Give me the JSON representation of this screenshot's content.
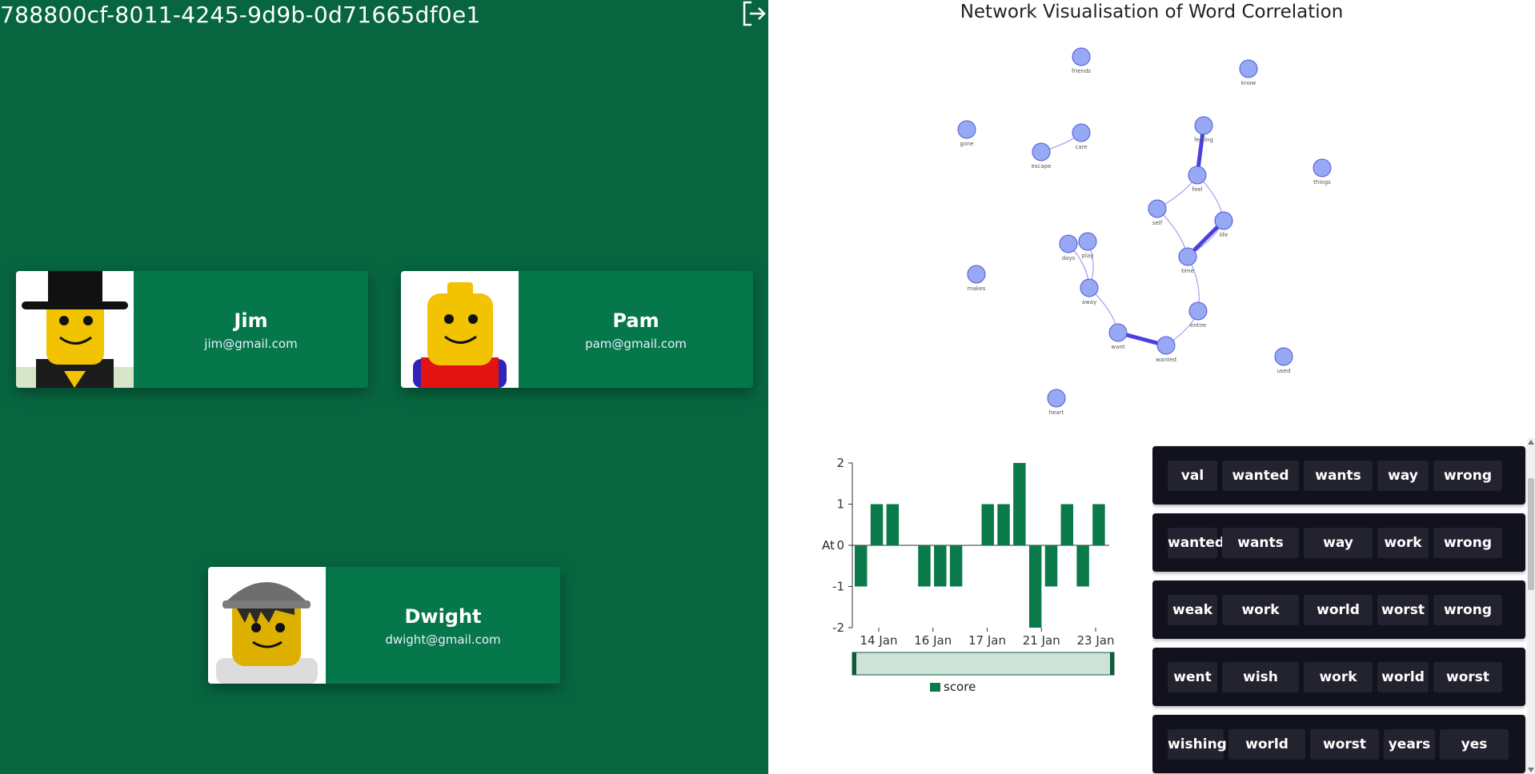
{
  "session": {
    "id": "788800cf-8011-4245-9d9b-0d71665df0e1"
  },
  "icons": {
    "logout": "logout-icon"
  },
  "users": [
    {
      "name": "Jim",
      "email": "jim@gmail.com",
      "avatar": "lego-minifig-top-hat"
    },
    {
      "name": "Pam",
      "email": "pam@gmail.com",
      "avatar": "lego-minifig-red-torso"
    },
    {
      "name": "Dwight",
      "email": "dwight@gmail.com",
      "avatar": "lego-minifig-grey-cap"
    }
  ],
  "network": {
    "title": "Network Visualisation of Word Correlation",
    "nodes": [
      "friends",
      "know",
      "gone",
      "care",
      "escape",
      "feeling",
      "feel",
      "things",
      "self",
      "life",
      "days",
      "play",
      "time",
      "makes",
      "away",
      "entire",
      "want",
      "wanted",
      "used",
      "heart"
    ],
    "edges": [
      {
        "source": "escape",
        "target": "care",
        "weight": 1
      },
      {
        "source": "feeling",
        "target": "feel",
        "weight": 4
      },
      {
        "source": "feel",
        "target": "self",
        "weight": 1
      },
      {
        "source": "feel",
        "target": "life",
        "weight": 1
      },
      {
        "source": "self",
        "target": "time",
        "weight": 1
      },
      {
        "source": "life",
        "target": "time",
        "weight": 1
      },
      {
        "source": "time",
        "target": "life",
        "weight": 4
      },
      {
        "source": "days",
        "target": "play",
        "weight": 1
      },
      {
        "source": "days",
        "target": "away",
        "weight": 1
      },
      {
        "source": "play",
        "target": "away",
        "weight": 1
      },
      {
        "source": "time",
        "target": "entire",
        "weight": 1
      },
      {
        "source": "away",
        "target": "want",
        "weight": 1
      },
      {
        "source": "want",
        "target": "wanted",
        "weight": 4
      },
      {
        "source": "wanted",
        "target": "entire",
        "weight": 1
      }
    ],
    "colors": {
      "node": "#97a8f4",
      "node_stroke": "#4f5ad6",
      "edge": "#4b3fe0"
    }
  },
  "chart_data": {
    "type": "bar",
    "title": "",
    "xlabel": "",
    "ylabel": "At",
    "ylim": [
      -2,
      2
    ],
    "y_ticks": [
      "2",
      "1",
      "0",
      "-1",
      "-2"
    ],
    "x_ticks": [
      "14 Jan",
      "16 Jan",
      "17 Jan",
      "21 Jan",
      "23 Jan"
    ],
    "series": [
      {
        "name": "score",
        "values": [
          -1,
          1,
          1,
          0,
          -1,
          -1,
          -1,
          0,
          1,
          1,
          2,
          -2,
          -1,
          1,
          -1,
          1
        ]
      }
    ],
    "color": "#0b7a4b",
    "legend": "bottom"
  },
  "word_groups": [
    [
      "val",
      "wanted",
      "wants",
      "way",
      "wrong"
    ],
    [
      "wanted",
      "wants",
      "way",
      "work",
      "wrong"
    ],
    [
      "weak",
      "work",
      "world",
      "worst",
      "wrong"
    ],
    [
      "went",
      "wish",
      "work",
      "world",
      "worst"
    ],
    [
      "wishing",
      "world",
      "worst",
      "years",
      "yes"
    ]
  ]
}
